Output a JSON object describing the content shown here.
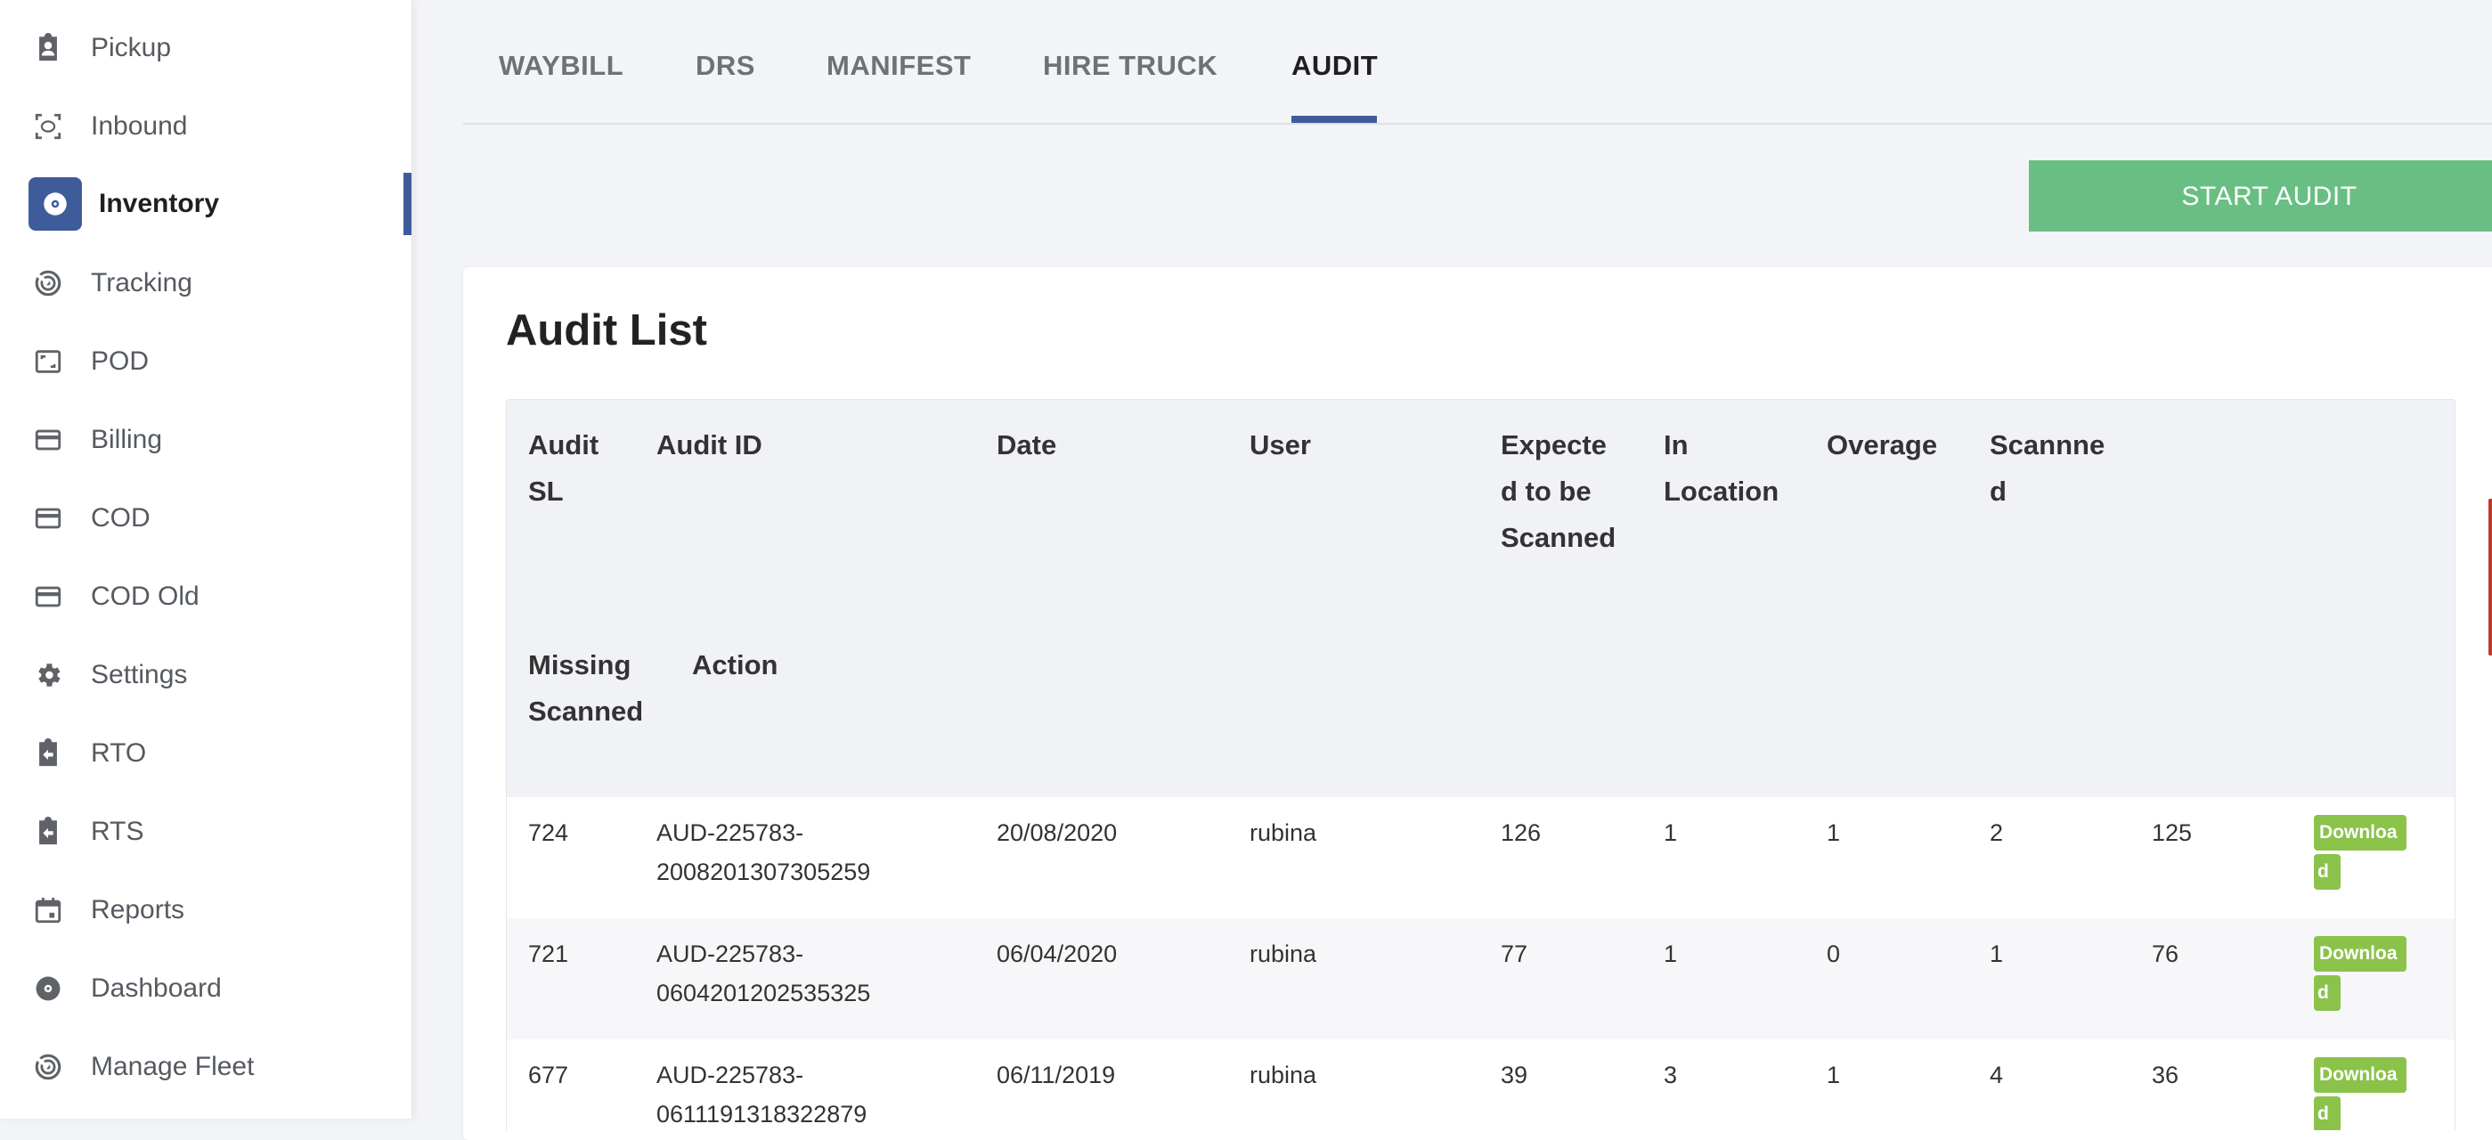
{
  "sidebar": {
    "items": [
      {
        "label": "Pickup",
        "icon": "clipboard-user-icon"
      },
      {
        "label": "Inbound",
        "icon": "scan-icon"
      },
      {
        "label": "Inventory",
        "icon": "inventory-disc-icon",
        "active": true
      },
      {
        "label": "Tracking",
        "icon": "radar-icon"
      },
      {
        "label": "POD",
        "icon": "image-frame-icon"
      },
      {
        "label": "Billing",
        "icon": "card-icon"
      },
      {
        "label": "COD",
        "icon": "card-icon"
      },
      {
        "label": "COD Old",
        "icon": "card-icon"
      },
      {
        "label": "Settings",
        "icon": "gear-icon"
      },
      {
        "label": "RTO",
        "icon": "clipboard-return-icon"
      },
      {
        "label": "RTS",
        "icon": "clipboard-return-icon"
      },
      {
        "label": "Reports",
        "icon": "calendar-icon"
      },
      {
        "label": "Dashboard",
        "icon": "disc-icon"
      },
      {
        "label": "Manage Fleet",
        "icon": "radar-icon"
      }
    ]
  },
  "tabs": [
    "WAYBILL",
    "DRS",
    "MANIFEST",
    "HIRE TRUCK",
    "AUDIT"
  ],
  "active_tab": "AUDIT",
  "start_audit_label": "START AUDIT",
  "audit_list": {
    "title": "Audit List",
    "headers": {
      "audit_sl": [
        "Audit",
        "SL"
      ],
      "audit_id": "Audit ID",
      "date": "Date",
      "user": "User",
      "expected": [
        "Expecte",
        "d to be",
        "Scanned"
      ],
      "in_location": [
        "In",
        "Location"
      ],
      "overage": "Overage",
      "scanned": [
        "Scannne",
        "d"
      ],
      "missing_scanned": [
        "Missing",
        "Scanned"
      ],
      "action": "Action"
    },
    "rows": [
      {
        "sl": "724",
        "id_1": "AUD-225783-",
        "id_2": "2008201307305259",
        "date": "20/08/2020",
        "user": "rubina",
        "expected": "126",
        "in_location": "1",
        "overage": "1",
        "scanned": "2",
        "missing": "125",
        "action_1": "Downloa",
        "action_2": "d"
      },
      {
        "sl": "721",
        "id_1": "AUD-225783-",
        "id_2": "0604201202535325",
        "date": "06/04/2020",
        "user": "rubina",
        "expected": "77",
        "in_location": "1",
        "overage": "0",
        "scanned": "1",
        "missing": "76",
        "action_1": "Downloa",
        "action_2": "d"
      },
      {
        "sl": "677",
        "id_1": "AUD-225783-",
        "id_2": "0611191318322879",
        "date": "06/11/2019",
        "user": "rubina",
        "expected": "39",
        "in_location": "3",
        "overage": "1",
        "scanned": "4",
        "missing": "36",
        "action_1": "Downloa",
        "action_2": "d"
      }
    ]
  },
  "colors": {
    "primary": "#3f5c9a",
    "start_button": "#69bf83",
    "download_button": "#8bc34a"
  }
}
